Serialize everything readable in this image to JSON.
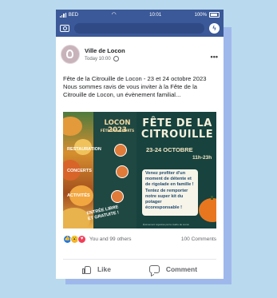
{
  "statusbar": {
    "carrier": "BED",
    "time": "10:01",
    "battery": "100%"
  },
  "post": {
    "page_name": "Ville de Locon",
    "timestamp": "Today 10:00",
    "text_line1": "Fête de la Citrouille de Locon - 23 et 24 octobre 2023",
    "text_line2": "Nous sommes ravis de vous inviter à la Fête de la Citrouille de Locon, un évènement familial..."
  },
  "poster": {
    "event_title_a": "LOCON 2023",
    "event_subtitle_a": "FÊTE DES SPORTS",
    "title_line1": "FÊTE DE LA",
    "title_line2": "CITROUILLE",
    "dates": "23-24 OCTOBRE",
    "hours": "11h-23h",
    "features": [
      "RESTAURATION",
      "CONCERTS",
      "ACTIVITÉS"
    ],
    "entry": "ENTRÉE LIBRE ET GRATUITE !",
    "info": "Venez profiter d'un moment de détente et de rigolade en famille ! Tentez de remporter notre super kit du potager écoresponsable !",
    "organizer": "Événement organisé par la mairie de Locon"
  },
  "reactions": {
    "summary": "You and 99 others",
    "comments": "100 Comments"
  },
  "actions": {
    "like_label": "Like",
    "comment_label": "Comment"
  },
  "colors": {
    "facebook_blue": "#3b5998",
    "background": "#b9d9ee",
    "accent": "#9fb8ec"
  }
}
